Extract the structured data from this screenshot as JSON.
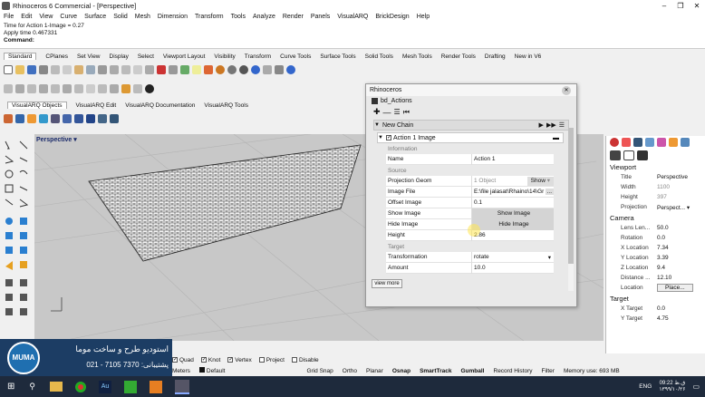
{
  "window": {
    "title": "Rhinoceros 6 Commercial - [Perspective]"
  },
  "menu": [
    "File",
    "Edit",
    "View",
    "Curve",
    "Surface",
    "Solid",
    "Mesh",
    "Dimension",
    "Transform",
    "Tools",
    "Analyze",
    "Render",
    "Panels",
    "VisualARQ",
    "BrickDesign",
    "Help"
  ],
  "command_history": [
    "Time for Action 1-Image = 0.27",
    "Apply time 0.467331"
  ],
  "command_label": "Command:",
  "toolbar_tabs": [
    "Standard",
    "CPlanes",
    "Set View",
    "Display",
    "Select",
    "Viewport Layout",
    "Visibility",
    "Transform",
    "Curve Tools",
    "Surface Tools",
    "Solid Tools",
    "Mesh Tools",
    "Render Tools",
    "Drafting",
    "New in V6"
  ],
  "visualarq_tabs": [
    "VisualARQ Objects",
    "VisualARQ Edit",
    "VisualARQ Documentation",
    "VisualARQ Tools"
  ],
  "viewport": {
    "label": "Perspective"
  },
  "dialog": {
    "title": "Rhinoceros",
    "subtitle": "bd_Actions",
    "chain": "New Chain",
    "action": "Action 1 Image",
    "sec_information": "Information",
    "sec_source": "Source",
    "sec_target": "Target",
    "name_k": "Name",
    "name_v": "Action 1",
    "proj_k": "Projection Geom",
    "proj_v": "1 Object",
    "proj_btn": "Show",
    "img_k": "Image File",
    "img_v": "E:\\file jalasat\\Rhaino\\14\\Gr",
    "off_k": "Offset Image",
    "off_v": "0.1",
    "show_k": "Show Image",
    "show_v": "Show Image",
    "hide_k": "Hide Image",
    "hide_v": "Hide Image",
    "height_k": "Height",
    "height_v": "2.86",
    "trans_k": "Transformation",
    "trans_v": "rotate",
    "amount_k": "Amount",
    "amount_v": "10.0",
    "view_more": "view more"
  },
  "properties": {
    "viewport_h": "Viewport",
    "title_k": "Title",
    "title_v": "Perspective",
    "width_k": "Width",
    "width_v": "1100",
    "height_k": "Height",
    "height_v": "397",
    "projection_k": "Projection",
    "projection_v": "Perspect...",
    "camera_h": "Camera",
    "lens_k": "Lens Len...",
    "lens_v": "50.0",
    "rot_k": "Rotation",
    "rot_v": "0.0",
    "xloc_k": "X Location",
    "xloc_v": "7.34",
    "yloc_k": "Y Location",
    "yloc_v": "3.39",
    "zloc_k": "Z Location",
    "zloc_v": "9.4",
    "dist_k": "Distance ...",
    "dist_v": "12.10",
    "loc_k": "Location",
    "loc_btn": "Place...",
    "target_h": "Target",
    "xt_k": "X Target",
    "xt_v": "0.0",
    "yt_k": "Y Target",
    "yt_v": "4.75"
  },
  "osnap": [
    {
      "label": "Quad",
      "checked": true
    },
    {
      "label": "Knot",
      "checked": true
    },
    {
      "label": "Vertex",
      "checked": true
    },
    {
      "label": "Project",
      "checked": false
    },
    {
      "label": "Disable",
      "checked": false
    }
  ],
  "status": [
    "Meters",
    "Default",
    "Grid Snap",
    "Ortho",
    "Planar",
    "Osnap",
    "SmartTrack",
    "Gumball",
    "Record History",
    "Filter",
    "Memory use: 693 MB"
  ],
  "brand": {
    "name": "MUMA",
    "line1": "استودیو طرح و ساخت موما",
    "line2": "پشتیبانی: 7370 7105 - 021"
  },
  "clock": {
    "time": "09:22 ق.ظ",
    "date": "۱۳۹۹/۱۰/۲۶",
    "lang": "ENG"
  }
}
